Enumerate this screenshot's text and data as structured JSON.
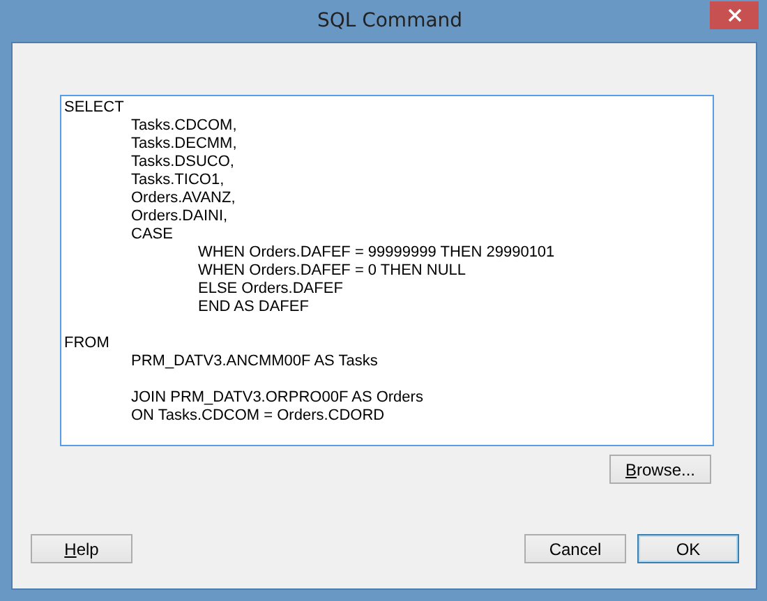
{
  "window": {
    "title": "SQL Command"
  },
  "sql": {
    "value": "SELECT\n\tTasks.CDCOM,\n\tTasks.DECMM,\n\tTasks.DSUCO,\n\tTasks.TICO1,\n\tOrders.AVANZ,\n\tOrders.DAINI,\n\tCASE\n\t\tWHEN Orders.DAFEF = 99999999 THEN 29990101\n\t\tWHEN Orders.DAFEF = 0 THEN NULL\n\t\tELSE Orders.DAFEF\n\t\tEND AS DAFEF\n\nFROM\n\tPRM_DATV3.ANCMM00F AS Tasks\n\n\tJOIN PRM_DATV3.ORPRO00F AS Orders\n\tON Tasks.CDCOM = Orders.CDORD"
  },
  "browse_button": {
    "label": "Browse...",
    "first_letter_underlined": true
  },
  "buttons": [
    {
      "label": "Help",
      "first_letter_underlined": true,
      "default": false
    },
    {
      "label": "Cancel",
      "default": false
    },
    {
      "label": "OK",
      "default": true
    }
  ]
}
